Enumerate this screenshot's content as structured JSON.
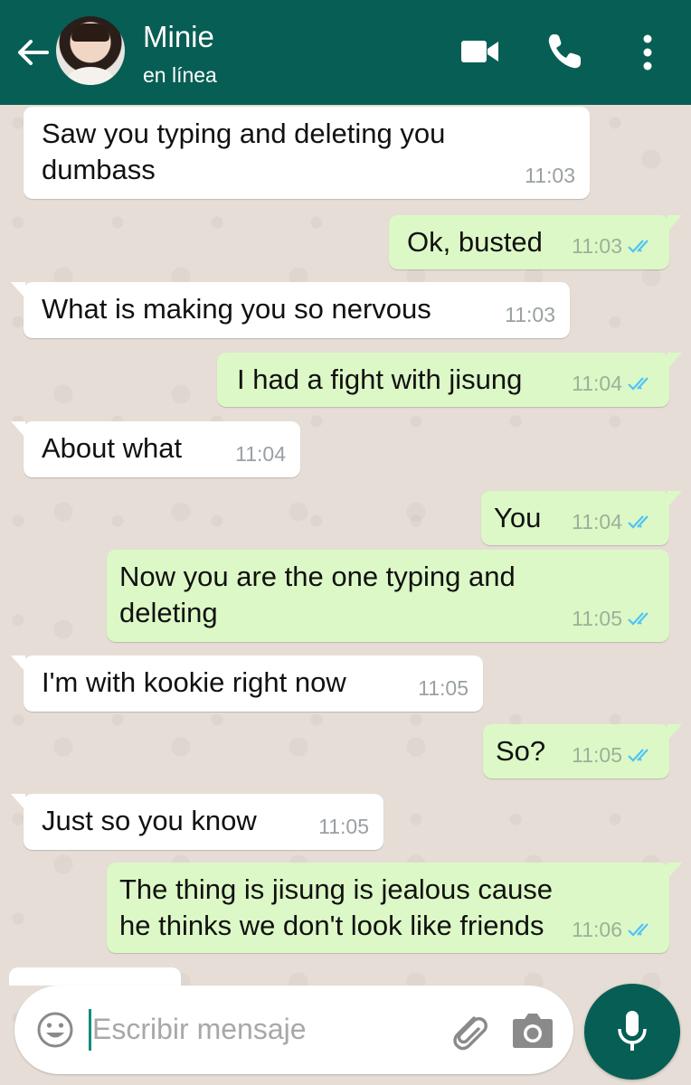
{
  "header": {
    "name": "Minie",
    "status": "en línea",
    "icons": [
      "back-arrow-icon",
      "video-camera-icon",
      "phone-icon",
      "more-vertical-icon"
    ]
  },
  "messages": [
    {
      "direction": "in",
      "text": "Saw you typing and deleting you dumbass",
      "time": "11:03"
    },
    {
      "direction": "out",
      "text": "Ok, busted",
      "time": "11:03",
      "read": true
    },
    {
      "direction": "in",
      "text": "What is making you so nervous",
      "time": "11:03"
    },
    {
      "direction": "out",
      "text": "I had a fight with jisung",
      "time": "11:04",
      "read": true
    },
    {
      "direction": "in",
      "text": "About what",
      "time": "11:04"
    },
    {
      "direction": "out",
      "text": "You",
      "time": "11:04",
      "read": true
    },
    {
      "direction": "out",
      "text": "Now you are the one typing and deleting",
      "time": "11:05",
      "read": true
    },
    {
      "direction": "in",
      "text": "I'm with kookie right now",
      "time": "11:05"
    },
    {
      "direction": "out",
      "text": "So?",
      "time": "11:05",
      "read": true
    },
    {
      "direction": "in",
      "text": "Just so you know",
      "time": "11:05"
    },
    {
      "direction": "out",
      "text": "The thing is jisung is jealous cause he thinks we don't look like friends",
      "time": "11:06",
      "read": true
    }
  ],
  "composer": {
    "placeholder": "Escribir mensaje",
    "icons": [
      "emoji-icon",
      "attach-icon",
      "camera-icon",
      "mic-icon"
    ]
  },
  "colors": {
    "header": "#075e54",
    "outgoing_bubble": "#dcf8c6",
    "incoming_bubble": "#ffffff",
    "read_ticks": "#4fc3f7"
  }
}
